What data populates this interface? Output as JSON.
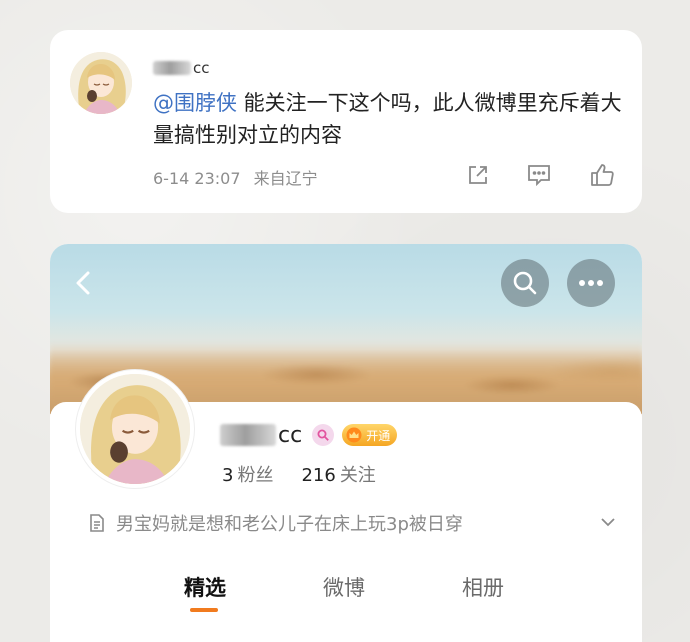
{
  "comment": {
    "username_suffix": "cc",
    "mention": "@围脖侠",
    "text": " 能关注一下这个吗，此人微博里充斥着大量搞性别对立的内容",
    "time": "6-14 23:07",
    "location": "来自辽宁",
    "actions": [
      "share-icon",
      "comment-icon",
      "like-icon"
    ]
  },
  "profile": {
    "username_suffix": "cc",
    "badge_vip": "开通",
    "followers_count": "3",
    "followers_label": "粉丝",
    "following_count": "216",
    "following_label": "关注",
    "bio": "男宝妈就是想和老公儿子在床上玩3p被日穿",
    "nav_icons": [
      "back-icon",
      "search-icon",
      "more-icon"
    ]
  },
  "tabs": [
    {
      "label": "精选",
      "active": true
    },
    {
      "label": "微博",
      "active": false
    },
    {
      "label": "相册",
      "active": false
    }
  ],
  "colors": {
    "mention": "#3f72c3",
    "tab_indicator": "#f17b1f",
    "vip_badge": "#f5a623"
  }
}
